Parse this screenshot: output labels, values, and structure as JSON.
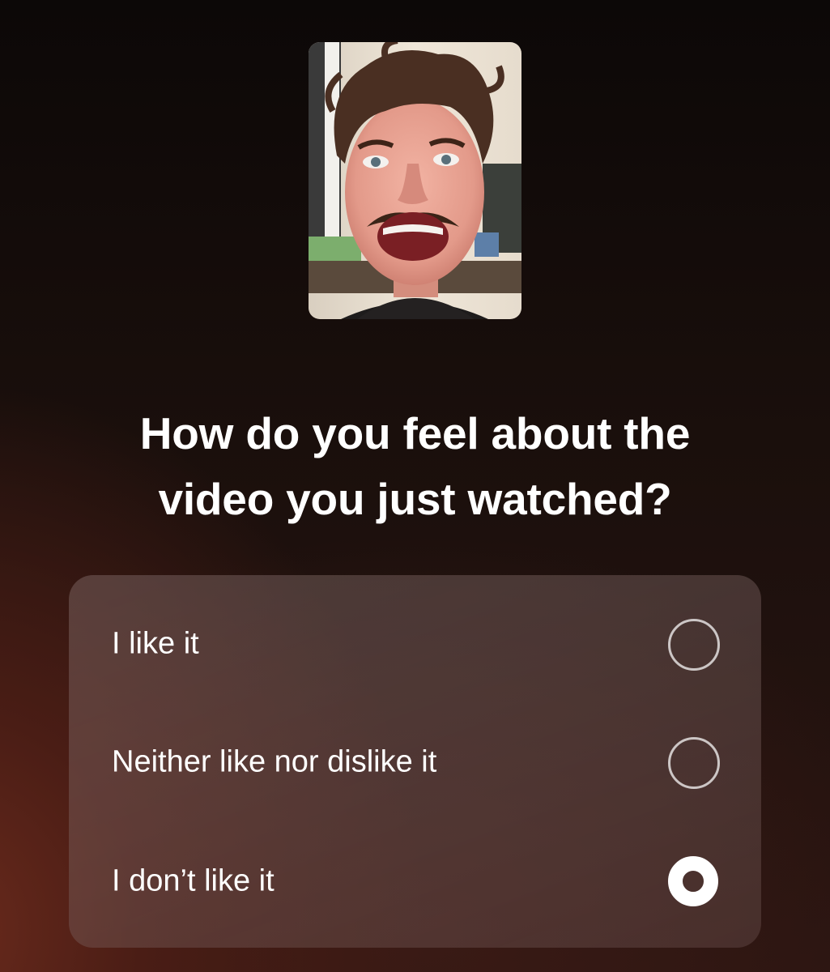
{
  "video_thumbnail": {
    "icon": "video-thumbnail-image"
  },
  "survey": {
    "question_line1": "How do you feel about the",
    "question_line2": "video you just watched?",
    "options": [
      {
        "label": "I like it",
        "selected": false
      },
      {
        "label": "Neither like nor dislike it",
        "selected": false
      },
      {
        "label": "I don’t like it",
        "selected": true
      }
    ]
  },
  "colors": {
    "text": "#ffffff",
    "radio_outline": "#bdbdbd",
    "radio_selected": "#ffffff"
  }
}
